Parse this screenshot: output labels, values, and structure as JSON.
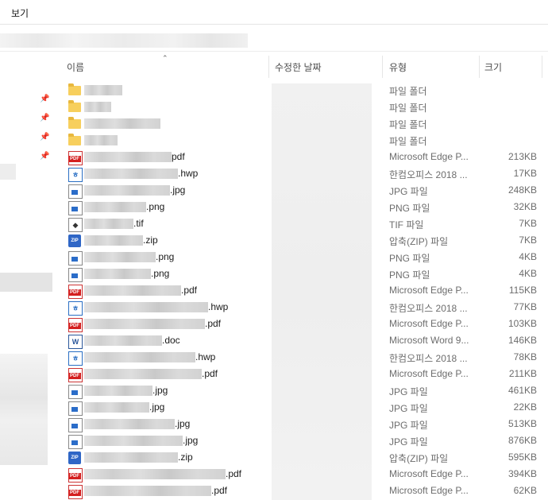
{
  "menubar": {
    "view_label": "보기"
  },
  "header": {
    "name": "이름",
    "date": "수정한 날짜",
    "type": "유형",
    "size": "크기"
  },
  "files": [
    {
      "icon": "folder-icon",
      "kind": "folder",
      "ext": "",
      "type": "파일 폴더",
      "size": ""
    },
    {
      "icon": "folder-icon",
      "kind": "folder",
      "ext": "",
      "type": "파일 폴더",
      "size": ""
    },
    {
      "icon": "folder-icon",
      "kind": "folder",
      "ext": "",
      "type": "파일 폴더",
      "size": ""
    },
    {
      "icon": "folder-icon",
      "kind": "folder",
      "ext": "",
      "type": "파일 폴더",
      "size": ""
    },
    {
      "icon": "pdf-icon",
      "kind": "pdf",
      "ext": "pdf",
      "type": "Microsoft Edge P...",
      "size": "213KB"
    },
    {
      "icon": "hwp-icon",
      "kind": "hwp",
      "ext": ".hwp",
      "type": "한컴오피스 2018 ...",
      "size": "17KB"
    },
    {
      "icon": "image-icon",
      "kind": "img",
      "ext": ".jpg",
      "type": "JPG 파일",
      "size": "248KB"
    },
    {
      "icon": "image-icon",
      "kind": "img",
      "ext": ".png",
      "type": "PNG 파일",
      "size": "32KB"
    },
    {
      "icon": "tif-icon",
      "kind": "tif",
      "ext": ".tif",
      "type": "TIF 파일",
      "size": "7KB"
    },
    {
      "icon": "zip-icon",
      "kind": "zip",
      "ext": ".zip",
      "type": "압축(ZIP) 파일",
      "size": "7KB"
    },
    {
      "icon": "image-icon",
      "kind": "img",
      "ext": ".png",
      "type": "PNG 파일",
      "size": "4KB"
    },
    {
      "icon": "image-icon",
      "kind": "img",
      "ext": ".png",
      "type": "PNG 파일",
      "size": "4KB"
    },
    {
      "icon": "pdf-icon",
      "kind": "pdf",
      "ext": ".pdf",
      "type": "Microsoft Edge P...",
      "size": "115KB"
    },
    {
      "icon": "hwp-icon",
      "kind": "hwp",
      "ext": ".hwp",
      "type": "한컴오피스 2018 ...",
      "size": "77KB"
    },
    {
      "icon": "pdf-icon",
      "kind": "pdf",
      "ext": ".pdf",
      "type": "Microsoft Edge P...",
      "size": "103KB"
    },
    {
      "icon": "word-doc-icon",
      "kind": "doc",
      "ext": ".doc",
      "type": "Microsoft Word 9...",
      "size": "146KB"
    },
    {
      "icon": "hwp-icon",
      "kind": "hwp",
      "ext": ".hwp",
      "type": "한컴오피스 2018 ...",
      "size": "78KB"
    },
    {
      "icon": "pdf-icon",
      "kind": "pdf",
      "ext": ".pdf",
      "type": "Microsoft Edge P...",
      "size": "211KB"
    },
    {
      "icon": "image-icon",
      "kind": "img",
      "ext": ".jpg",
      "type": "JPG 파일",
      "size": "461KB"
    },
    {
      "icon": "image-icon",
      "kind": "img",
      "ext": ".jpg",
      "type": "JPG 파일",
      "size": "22KB"
    },
    {
      "icon": "image-icon",
      "kind": "img",
      "ext": ".jpg",
      "type": "JPG 파일",
      "size": "513KB"
    },
    {
      "icon": "image-icon",
      "kind": "img",
      "ext": ".jpg",
      "type": "JPG 파일",
      "size": "876KB"
    },
    {
      "icon": "zip-icon",
      "kind": "zip",
      "ext": ".zip",
      "type": "압축(ZIP) 파일",
      "size": "595KB"
    },
    {
      "icon": "pdf-icon",
      "kind": "pdf",
      "ext": ".pdf",
      "type": "Microsoft Edge P...",
      "size": "394KB"
    },
    {
      "icon": "pdf-icon",
      "kind": "pdf",
      "ext": ".pdf",
      "type": "Microsoft Edge P...",
      "size": "62KB"
    }
  ]
}
